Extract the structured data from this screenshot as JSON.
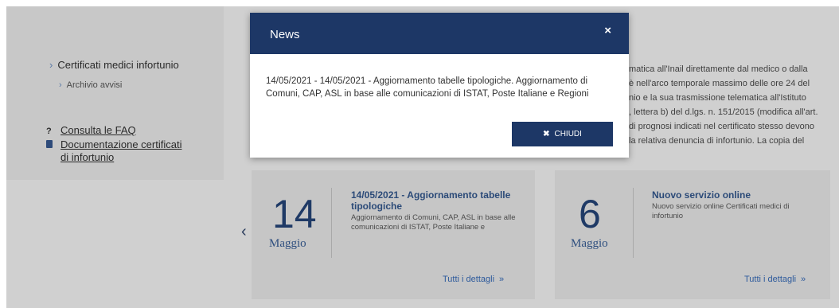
{
  "sidebar": {
    "main_link": "Certificati medici infortunio",
    "sub_link": "Archivio avvisi",
    "faq_label": "Consulta le FAQ",
    "doc_label": "Documentazione certificati di infortunio"
  },
  "background_text": [
    "matica all'Inail direttamente dal medico o dalla",
    "è nell'arco temporale massimo delle ore 24 del",
    "nio e la sua trasmissione telematica all'Istituto",
    ", lettera b) del d.lgs. n. 151/2015 (modifica all'art.",
    "di prognosi indicati nel certificato stesso devono",
    "la relativa denuncia di infortunio. La copia del"
  ],
  "news_cards": [
    {
      "day": "14",
      "month": "Maggio",
      "title": "14/05/2021 - Aggiornamento tabelle tipologiche",
      "description": "Aggiornamento di Comuni, CAP, ASL in base alle comunicazioni di ISTAT, Poste Italiane e",
      "more_label": "Tutti i dettagli"
    },
    {
      "day": "6",
      "month": "Maggio",
      "title": "Nuovo servizio online",
      "description": "Nuovo servizio online Certificati medici di infortunio",
      "more_label": "Tutti i dettagli"
    }
  ],
  "modal": {
    "title": "News",
    "close_icon": "×",
    "body": "14/05/2021 - 14/05/2021 - Aggiornamento tabelle tipologiche. Aggiornamento di Comuni, CAP, ASL in base alle comunicazioni di ISTAT, Poste Italiane e Regioni",
    "button_label": "CHIUDI",
    "button_icon": "✖"
  },
  "colors": {
    "primary": "#1d3766",
    "link": "#2d5a9c"
  }
}
